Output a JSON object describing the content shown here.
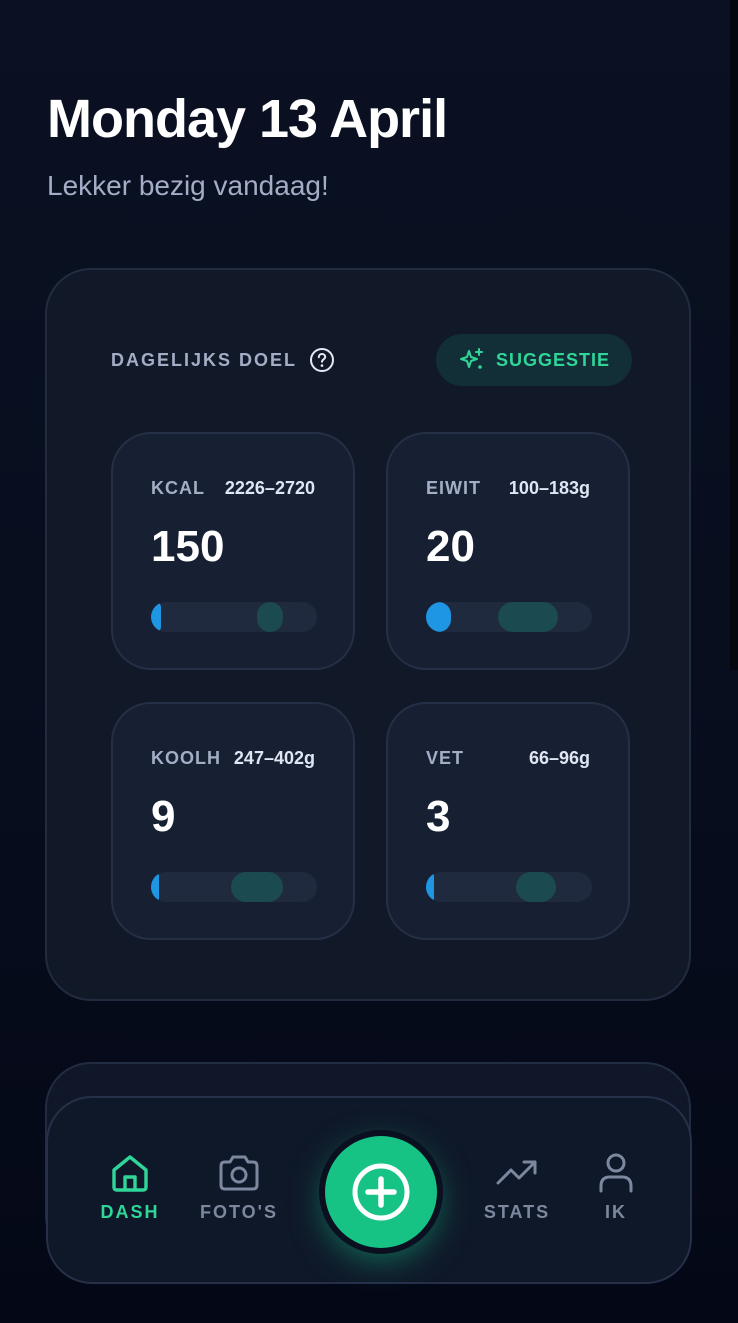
{
  "header": {
    "title": "Monday 13 April",
    "subtitle": "Lekker bezig vandaag!"
  },
  "goal": {
    "label": "DAGELIJKS DOEL",
    "help_icon": "question-circle-icon",
    "suggest_icon": "sparkles-icon",
    "suggest_label": "SUGGESTIE",
    "macros": [
      {
        "name": "KCAL",
        "range": "2226–2720",
        "value": "150",
        "progress": 0.06
      },
      {
        "name": "EIWIT",
        "range": "100–183g",
        "value": "20",
        "progress": 0.15
      },
      {
        "name": "KOOLH",
        "range": "247–402g",
        "value": "9",
        "progress": 0.03
      },
      {
        "name": "VET",
        "range": "66–96g",
        "value": "3",
        "progress": 0.04
      }
    ]
  },
  "nav": {
    "items": [
      {
        "label": "DASH",
        "icon": "home-icon",
        "active": true
      },
      {
        "label": "FOTO'S",
        "icon": "camera-icon",
        "active": false
      },
      {
        "label": "STATS",
        "icon": "trending-up-icon",
        "active": false
      },
      {
        "label": "IK",
        "icon": "user-icon",
        "active": false
      }
    ],
    "add_icon": "plus-circle-icon"
  },
  "colors": {
    "accent_green": "#2fd698",
    "progress_blue": "#1e96e4",
    "background": "#060c1c"
  }
}
